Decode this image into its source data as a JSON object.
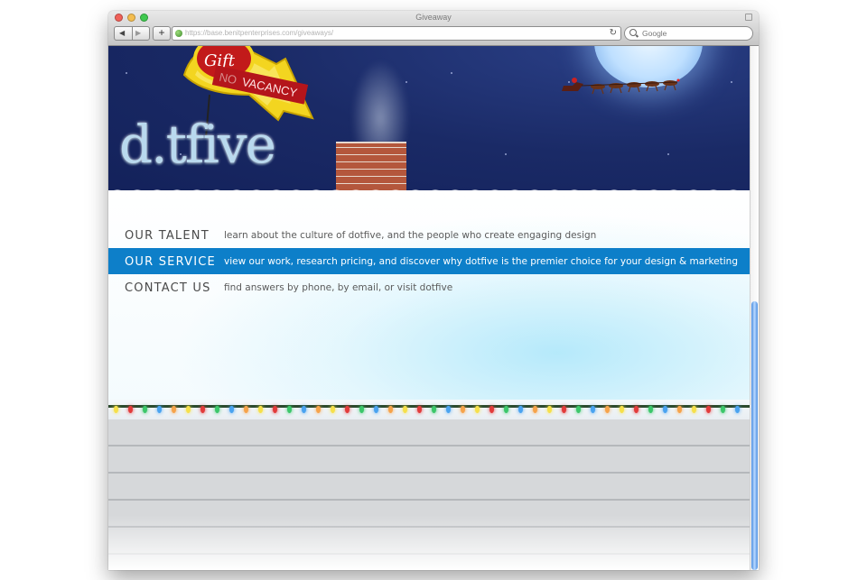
{
  "browser": {
    "window_title": "Giveaway",
    "url": "https://base.benitpenterprises.com/giveaways/",
    "search_placeholder": "Google"
  },
  "header": {
    "logo_text": "d.tfive",
    "sign": {
      "gift_text": "Gift",
      "no_text": "NO",
      "vacancy_text": "VACANCY"
    }
  },
  "menu": {
    "items": [
      {
        "label": "OUR TALENT",
        "description": "learn about the culture of dotfive, and the people who create engaging design",
        "active": false
      },
      {
        "label": "OUR SERVICE",
        "description": "view our work, research pricing, and discover why dotfive is the premier choice for your design & marketing",
        "active": true
      },
      {
        "label": "CONTACT US",
        "description": "find answers by phone, by email, or visit dotfive",
        "active": false
      }
    ]
  },
  "colors": {
    "active_menu": "#0d7fc9",
    "night_sky": "#1a2a66",
    "scroll_thumb": "#4a8ee0"
  },
  "icons": [
    "close-icon",
    "minimize-icon",
    "maximize-icon",
    "back-icon",
    "forward-icon",
    "add-icon",
    "globe-icon",
    "reload-icon",
    "magnifier-icon",
    "lock-icon"
  ]
}
